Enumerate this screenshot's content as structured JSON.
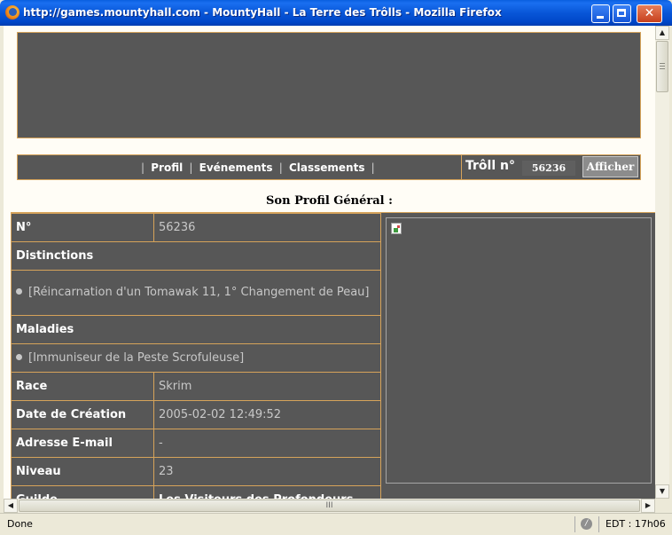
{
  "window": {
    "title": "http://games.mountyhall.com - MountyHall - La Terre des Trôlls - Mozilla Firefox",
    "close_glyph": "✕"
  },
  "menu": {
    "sep": "|",
    "items": [
      {
        "label": "Profil"
      },
      {
        "label": "Evénements"
      },
      {
        "label": "Classements"
      }
    ],
    "troll_label": "Trôll n°",
    "troll_number": "56236",
    "afficher_label": "Afficher"
  },
  "section_title": "Son Profil Général :",
  "profile": {
    "numero": {
      "label": "N°",
      "value": "56236"
    },
    "distinctions": {
      "label": "Distinctions",
      "value": "[Réincarnation d'un Tomawak 11, 1° Changement de Peau]"
    },
    "maladies": {
      "label": "Maladies",
      "value": "[Immuniseur de la Peste Scrofuleuse]"
    },
    "race": {
      "label": "Race",
      "value": "Skrim"
    },
    "date_creation": {
      "label": "Date de Création",
      "value": "2005-02-02 12:49:52"
    },
    "email": {
      "label": "Adresse E-mail",
      "value": "-"
    },
    "niveau": {
      "label": "Niveau",
      "value": "23"
    },
    "guilde": {
      "label": "Guilde",
      "value": "Les Visiteurs des Profondeurs"
    }
  },
  "scrollbars": {
    "thumb_grip": "III"
  },
  "status": {
    "text": "Done",
    "clock": "EDT : 17h06"
  },
  "icons": {
    "app": "firefox-icon",
    "broken_image": "broken-image-icon",
    "status": "no-signature-icon"
  }
}
